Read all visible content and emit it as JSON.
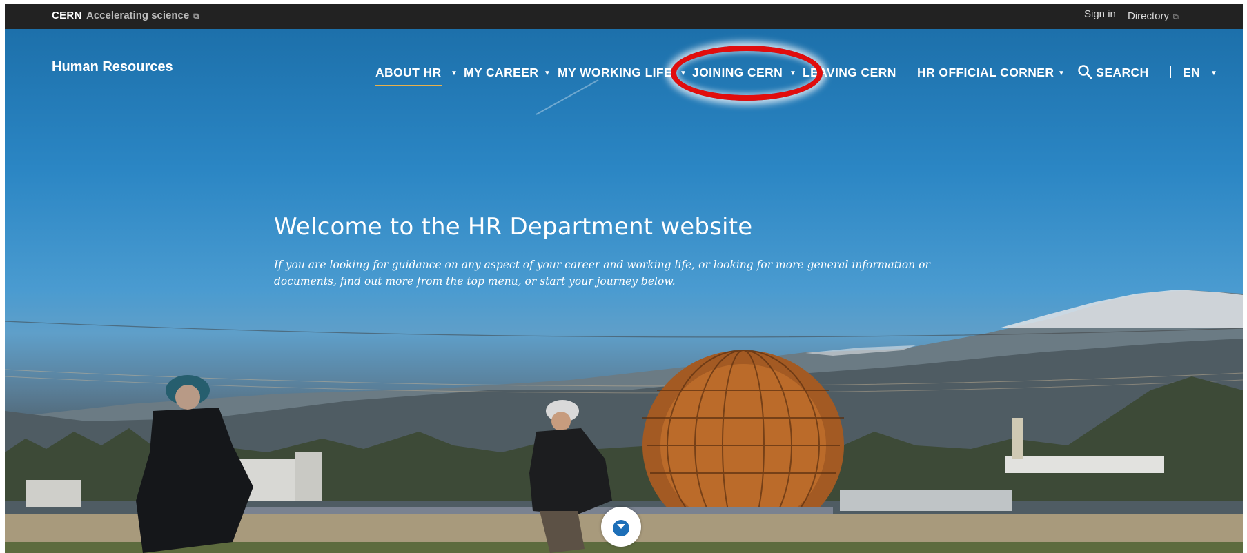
{
  "topbar": {
    "org": "CERN",
    "tagline": "Accelerating science",
    "sign_in": "Sign in",
    "directory": "Directory",
    "external_icon": "external-link-icon"
  },
  "header": {
    "site_title": "Human Resources"
  },
  "nav": {
    "items": [
      {
        "label": "ABOUT HR",
        "dropdown": true,
        "active": true
      },
      {
        "label": "MY CAREER",
        "dropdown": true
      },
      {
        "label": "MY WORKING LIFE",
        "dropdown": true
      },
      {
        "label": "JOINING CERN",
        "dropdown": true,
        "annotated": true
      },
      {
        "label": "LEAVING CERN",
        "dropdown": false
      },
      {
        "label": "HR OFFICIAL CORNER",
        "dropdown": true
      }
    ],
    "search_label": "SEARCH",
    "search_icon": "search-icon",
    "language": "EN"
  },
  "hero": {
    "title": "Welcome to the HR Department website",
    "subtitle": "If you are looking for guidance on any aspect of your career and working life, or looking for more general information or documents, find out more from the top menu, or start your journey below.",
    "scroll_icon": "chevron-down-icon"
  },
  "colors": {
    "topbar_bg": "#222222",
    "active_underline": "#e9b04b",
    "annotation": "#e10d0d",
    "scroll_chevron": "#1d6fb8"
  }
}
